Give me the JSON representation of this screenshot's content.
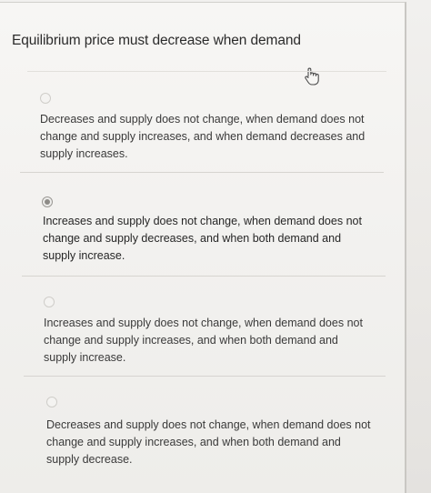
{
  "question": {
    "text": "Equilibrium price must decrease when demand"
  },
  "options": [
    {
      "label": "Decreases and supply does not change, when demand does not change and supply increases, and when demand decreases and supply increases.",
      "selected": false
    },
    {
      "label": "Increases and supply does not change, when demand does not change and supply decreases, and when both demand and supply increase.",
      "selected": true
    },
    {
      "label": "Increases and supply does not change, when demand does not change and supply increases, and when both demand and supply increase.",
      "selected": false
    },
    {
      "label": "Decreases and supply does not change, when demand does not change and supply increases, and when both demand and supply decrease.",
      "selected": false
    }
  ],
  "icons": {
    "cursor": "hand-pointer-icon"
  }
}
